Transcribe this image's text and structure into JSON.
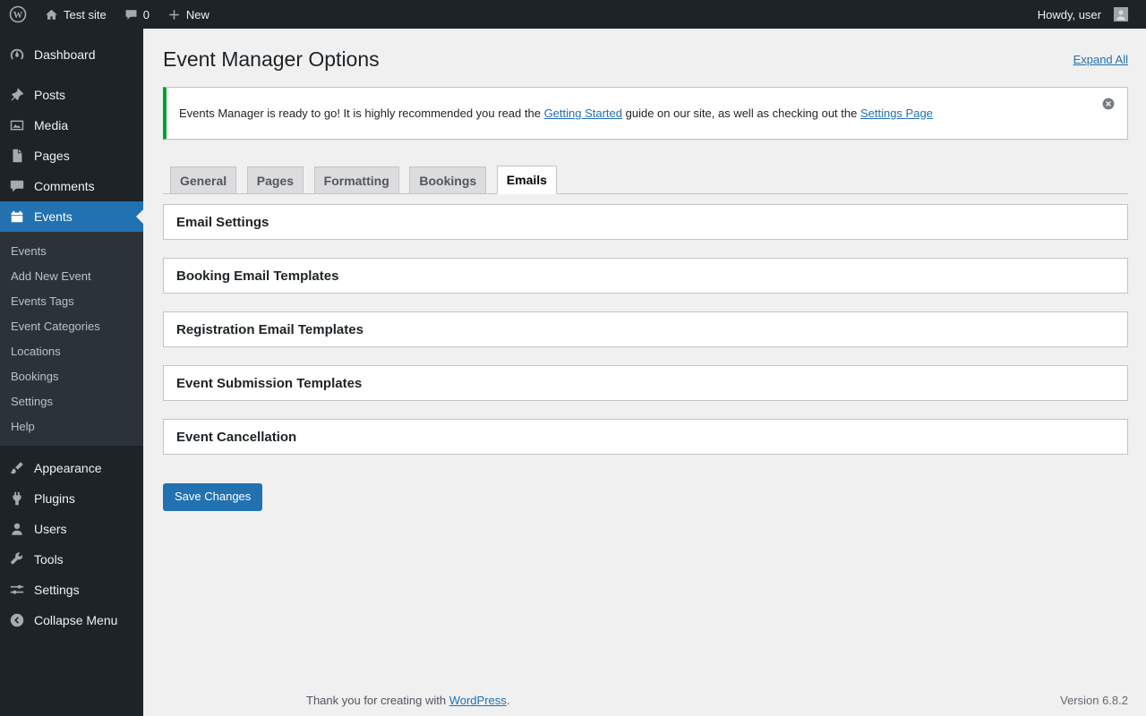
{
  "admin_bar": {
    "site_name": "Test site",
    "comments_count": "0",
    "new_label": "New",
    "howdy_text": "Howdy, user"
  },
  "sidebar": {
    "items": {
      "dashboard": "Dashboard",
      "posts": "Posts",
      "media": "Media",
      "pages": "Pages",
      "comments": "Comments",
      "events": "Events",
      "appearance": "Appearance",
      "plugins": "Plugins",
      "users": "Users",
      "tools": "Tools",
      "settings": "Settings",
      "collapse": "Collapse Menu"
    },
    "events_submenu": [
      "Events",
      "Add New Event",
      "Events Tags",
      "Event Categories",
      "Locations",
      "Bookings",
      "Settings",
      "Help"
    ]
  },
  "main": {
    "page_title": "Event Manager Options",
    "expand_all_label": "Expand All",
    "notice": {
      "text_start": "Events Manager is ready to go! It is highly recommended you read the ",
      "getting_started_link": "Getting Started",
      "text_middle": " guide on our site, as well as checking out the ",
      "settings_page_link": "Settings Page"
    },
    "tabs": [
      "General",
      "Pages",
      "Formatting",
      "Bookings",
      "Emails"
    ],
    "active_tab": "Emails",
    "panels": [
      "Email Settings",
      "Booking Email Templates",
      "Registration Email Templates",
      "Event Submission Templates",
      "Event Cancellation"
    ],
    "save_button_label": "Save Changes"
  },
  "footer": {
    "thanks_text": "Thank you for creating with ",
    "wordpress_link": "WordPress",
    "period": ".",
    "version": "Version 6.8.2"
  },
  "colors": {
    "accent_blue": "#2271b1",
    "notice_green": "#00a32a",
    "admin_dark": "#1d2327"
  }
}
